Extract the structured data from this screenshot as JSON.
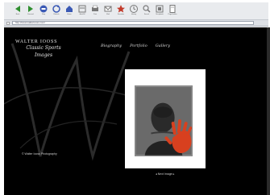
{
  "toolbar": {
    "buttons": [
      {
        "label": "Back",
        "icon": "back-arrow-icon",
        "color": "#2f8f2f"
      },
      {
        "label": "Forward",
        "icon": "forward-arrow-icon",
        "color": "#2f8f2f"
      },
      {
        "label": "Stop",
        "icon": "stop-icon",
        "color": "#3a59b5"
      },
      {
        "label": "Refresh",
        "icon": "refresh-icon",
        "color": "#3a59b5"
      },
      {
        "label": "Home",
        "icon": "home-icon",
        "color": "#3a59b5"
      },
      {
        "label": "AutoFill",
        "icon": "autofill-icon",
        "color": "#777777"
      },
      {
        "label": "Print",
        "icon": "print-icon",
        "color": "#777777"
      },
      {
        "label": "Mail",
        "icon": "mail-icon",
        "color": "#777777"
      },
      {
        "label": "Favorites",
        "icon": "favorites-icon",
        "color": "#c23a2a"
      },
      {
        "label": "History",
        "icon": "history-icon",
        "color": "#777777"
      },
      {
        "label": "Search",
        "icon": "search-icon",
        "color": "#777777"
      },
      {
        "label": "Scrapbook",
        "icon": "scrapbook-icon",
        "color": "#777777"
      },
      {
        "label": "Page Holder",
        "icon": "page-holder-icon",
        "color": "#777777"
      }
    ]
  },
  "address": {
    "url": "http://www.walteriooss.com/"
  },
  "site": {
    "name": "WALTER IOOSS",
    "script_line1": "Classic Sports",
    "script_line2": "Images",
    "nav": [
      "Biography",
      "Portfolio",
      "Gallery"
    ],
    "footer_link": "© Walter Iooss Photography",
    "caption": "◂  Next Image  ▸"
  },
  "colors": {
    "page_background": "#000000",
    "monogram": "#2b2b2b",
    "handprint": "#d8401f"
  }
}
